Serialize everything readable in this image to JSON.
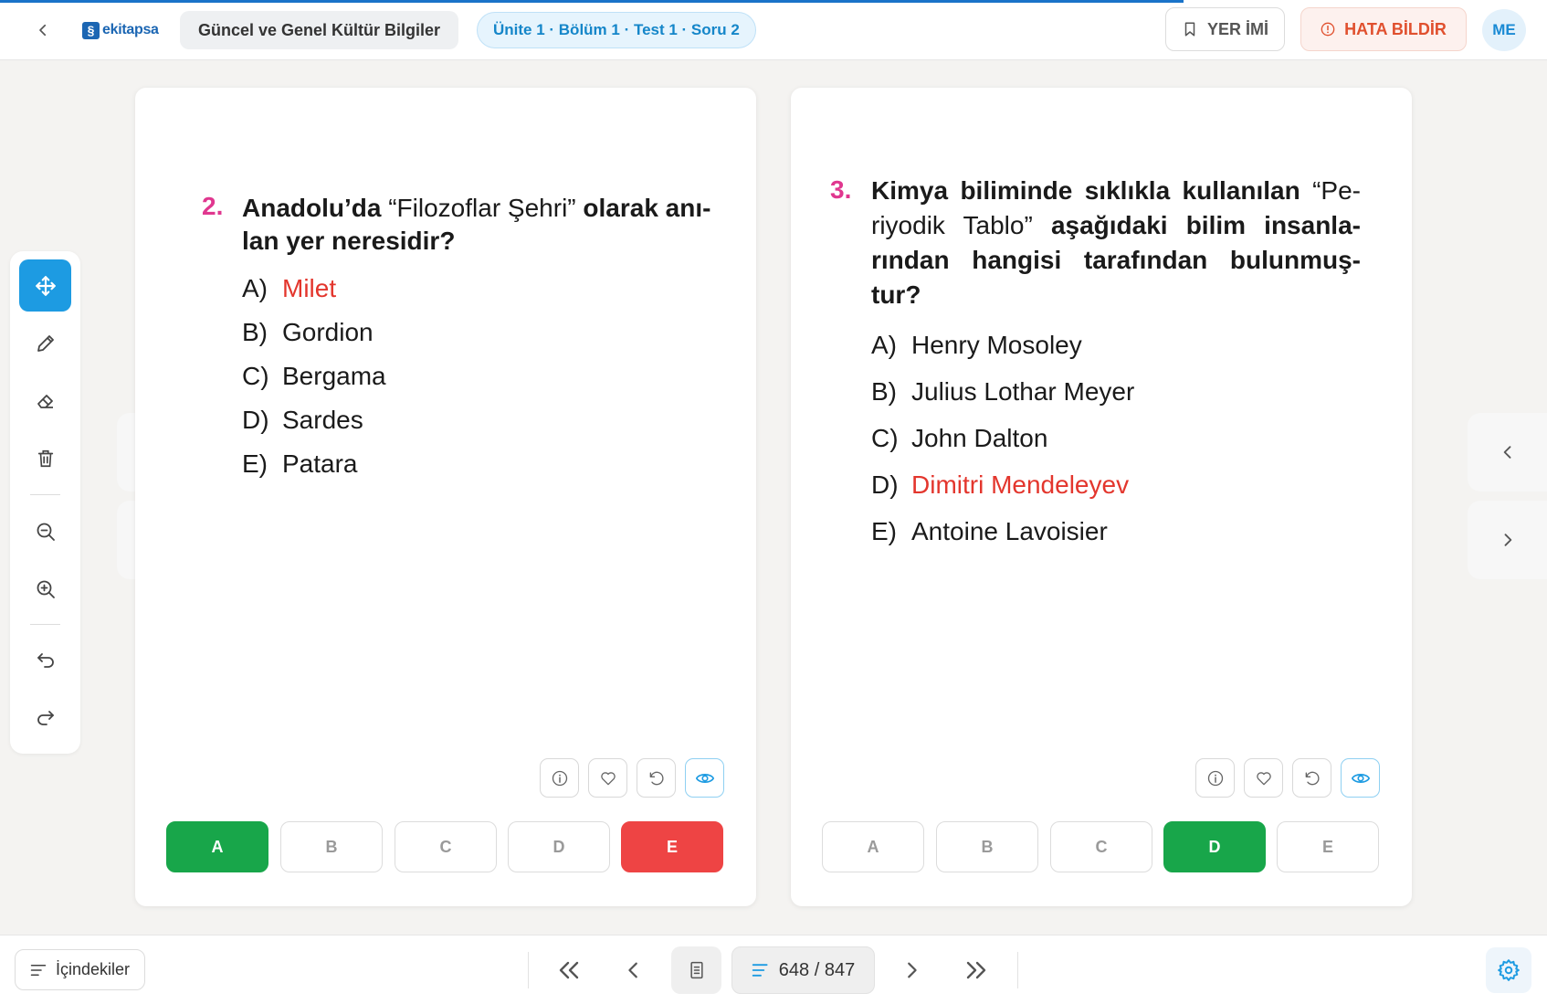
{
  "header": {
    "logo_text": "ekitapsa",
    "book_title": "Güncel ve Genel Kültür Bilgiler",
    "location": "Ünite 1 · Bölüm 1 · Test 1 · Soru 2",
    "bookmark_label": "YER İMİ",
    "report_label": "HATA BİLDİR",
    "avatar_initials": "ME",
    "progress_fraction": 0.765
  },
  "questions": [
    {
      "number": "2.",
      "segments": [
        {
          "text": "Anadolu’da ",
          "bold": true
        },
        {
          "text": "“Filozoflar Şehri” ",
          "bold": false
        },
        {
          "text": "olarak anı-",
          "bold": true
        }
      ],
      "line2": "lan yer neresidir?",
      "options": [
        {
          "letter": "A)",
          "text": "Milet",
          "highlight": true
        },
        {
          "letter": "B)",
          "text": "Gordion",
          "highlight": false
        },
        {
          "letter": "C)",
          "text": "Bergama",
          "highlight": false
        },
        {
          "letter": "D)",
          "text": "Sardes",
          "highlight": false
        },
        {
          "letter": "E)",
          "text": "Patara",
          "highlight": false
        }
      ],
      "answers": [
        "A",
        "B",
        "C",
        "D",
        "E"
      ],
      "correct": "A",
      "selected_wrong": "E"
    },
    {
      "number": "3.",
      "lines": [
        [
          {
            "text": "Kimya biliminde sıklıkla kullanılan ",
            "bold": true
          },
          {
            "text": "“Pe-",
            "bold": false
          }
        ],
        [
          {
            "text": "riyodik Tablo” ",
            "bold": false
          },
          {
            "text": "aşağıdaki bilim insanla-",
            "bold": true
          }
        ],
        [
          {
            "text": "rından hangisi tarafından bulunmuş-",
            "bold": true
          }
        ],
        [
          {
            "text": "tur?",
            "bold": true
          }
        ]
      ],
      "options": [
        {
          "letter": "A)",
          "text": "Henry Mosoley",
          "highlight": false
        },
        {
          "letter": "B)",
          "text": "Julius Lothar Meyer",
          "highlight": false
        },
        {
          "letter": "C)",
          "text": "John Dalton",
          "highlight": false
        },
        {
          "letter": "D)",
          "text": "Dimitri Mendeleyev",
          "highlight": true
        },
        {
          "letter": "E)",
          "text": "Antoine Lavoisier",
          "highlight": false
        }
      ],
      "answers": [
        "A",
        "B",
        "C",
        "D",
        "E"
      ],
      "correct": "D",
      "selected_wrong": ""
    }
  ],
  "footer": {
    "toc_label": "İçindekiler",
    "page_counter": "648 / 847"
  },
  "colors": {
    "accent": "#1d9be2",
    "correct": "#18a64a",
    "wrong": "#ee4444",
    "highlight_text": "#e3362d",
    "question_number": "#e0378f"
  }
}
